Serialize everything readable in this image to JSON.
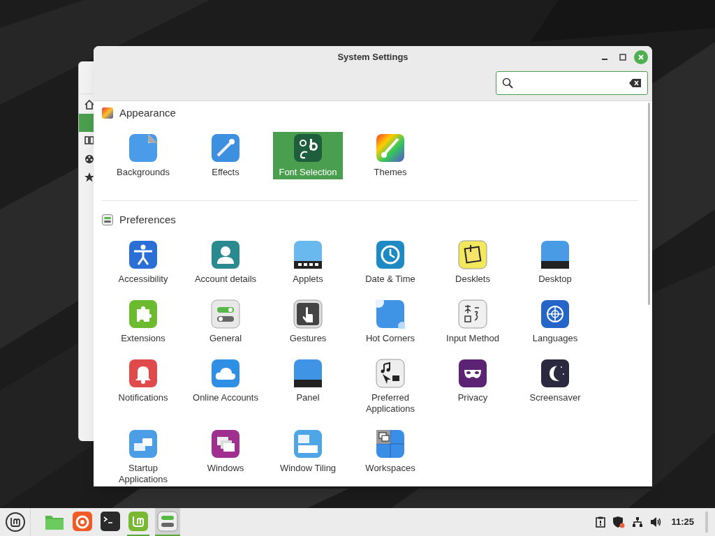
{
  "window": {
    "title": "System Settings"
  },
  "sections": [
    {
      "title": "Appearance",
      "items": [
        {
          "label": "Backgrounds",
          "selected": false
        },
        {
          "label": "Effects",
          "selected": false
        },
        {
          "label": "Font Selection",
          "selected": true
        },
        {
          "label": "Themes",
          "selected": false
        }
      ]
    },
    {
      "title": "Preferences",
      "items": [
        {
          "label": "Accessibility",
          "selected": false
        },
        {
          "label": "Account details",
          "selected": false
        },
        {
          "label": "Applets",
          "selected": false
        },
        {
          "label": "Date & Time",
          "selected": false
        },
        {
          "label": "Desklets",
          "selected": false
        },
        {
          "label": "Desktop",
          "selected": false
        },
        {
          "label": "Extensions",
          "selected": false
        },
        {
          "label": "General",
          "selected": false
        },
        {
          "label": "Gestures",
          "selected": false
        },
        {
          "label": "Hot Corners",
          "selected": false
        },
        {
          "label": "Input Method",
          "selected": false
        },
        {
          "label": "Languages",
          "selected": false
        },
        {
          "label": "Notifications",
          "selected": false
        },
        {
          "label": "Online Accounts",
          "selected": false
        },
        {
          "label": "Panel",
          "selected": false
        },
        {
          "label": "Preferred Applications",
          "selected": false
        },
        {
          "label": "Privacy",
          "selected": false
        },
        {
          "label": "Screensaver",
          "selected": false
        },
        {
          "label": "Startup Applications",
          "selected": false
        },
        {
          "label": "Windows",
          "selected": false
        },
        {
          "label": "Window Tiling",
          "selected": false
        },
        {
          "label": "Workspaces",
          "selected": false
        }
      ]
    }
  ],
  "taskbar": {
    "launchers": [
      {
        "kind": "files",
        "running": false
      },
      {
        "kind": "browser",
        "running": false
      },
      {
        "kind": "terminal",
        "running": false
      },
      {
        "kind": "mint",
        "running": true
      },
      {
        "kind": "settings",
        "running": true
      }
    ],
    "clock": "11:25"
  }
}
